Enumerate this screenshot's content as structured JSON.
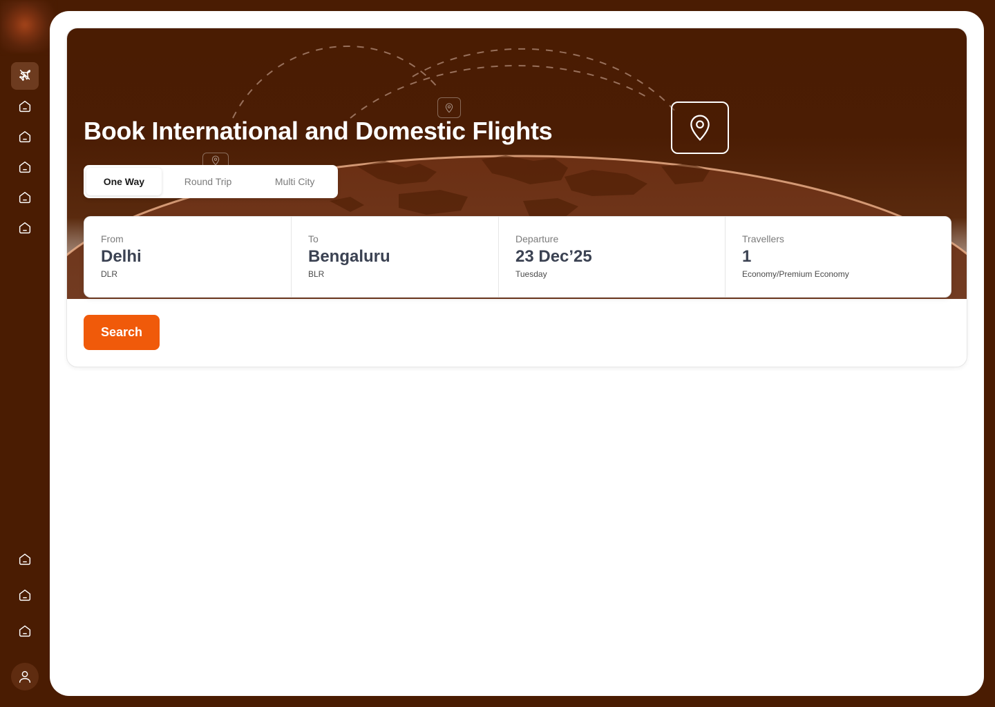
{
  "sidebar": {
    "nav_icons": [
      "flights-icon",
      "home-icon",
      "home-icon",
      "home-icon",
      "home-icon",
      "home-icon"
    ],
    "bottom_icons": [
      "home-icon",
      "home-icon",
      "home-icon"
    ],
    "profile_icon": "user-icon"
  },
  "hero": {
    "title": "Book International and Domestic Flights"
  },
  "trip_tabs": [
    {
      "label": "One Way",
      "selected": true
    },
    {
      "label": "Round Trip",
      "selected": false
    },
    {
      "label": "Multi City",
      "selected": false
    }
  ],
  "fields": {
    "from": {
      "label": "From",
      "value": "Delhi",
      "sub": "DLR"
    },
    "to": {
      "label": "To",
      "value": "Bengaluru",
      "sub": "BLR"
    },
    "departure": {
      "label": "Departure",
      "value": "23 Dec’25",
      "sub": "Tuesday"
    },
    "travellers": {
      "label": "Travellers",
      "value": "1",
      "sub": "Economy/Premium Economy"
    }
  },
  "search_label": "Search",
  "colors": {
    "brand_dark": "#4a1c02",
    "accent": "#f05a0a",
    "text_dark": "#3b4252"
  }
}
